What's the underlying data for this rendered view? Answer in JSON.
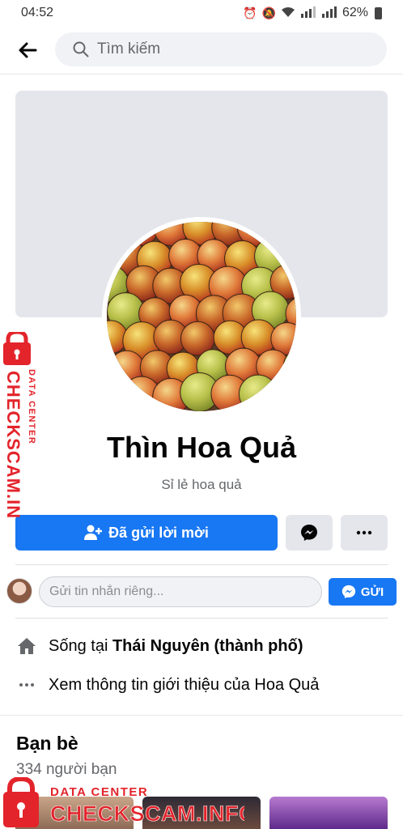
{
  "status_bar": {
    "time": "04:52",
    "battery": "62%"
  },
  "header": {
    "search_placeholder": "Tìm kiếm"
  },
  "profile": {
    "name": "Thìn Hoa Quả",
    "bio": "Sỉ lẻ hoa quả"
  },
  "actions": {
    "friend_request_label": "Đã gửi lời mời"
  },
  "message": {
    "placeholder": "Gửi tin nhắn riêng...",
    "send_label": "GỬI"
  },
  "intro": {
    "lives_prefix": "Sống tại ",
    "lives_place": "Thái Nguyên (thành phố)",
    "see_about": "Xem thông tin giới thiệu của Hoa Quả"
  },
  "friends": {
    "title": "Bạn bè",
    "count": "334 người bạn"
  },
  "watermark": {
    "line1": "DATA CENTER",
    "line2": "CHECKSCAM.INFO"
  },
  "colors": {
    "accent": "#1877f2",
    "watermark": "#e3242b",
    "secondary_text": "#65676b"
  },
  "icons": [
    "back-arrow-icon",
    "search-icon",
    "add-friend-icon",
    "messenger-icon",
    "more-icon",
    "home-icon",
    "ellipsis-icon",
    "lock-icon"
  ]
}
